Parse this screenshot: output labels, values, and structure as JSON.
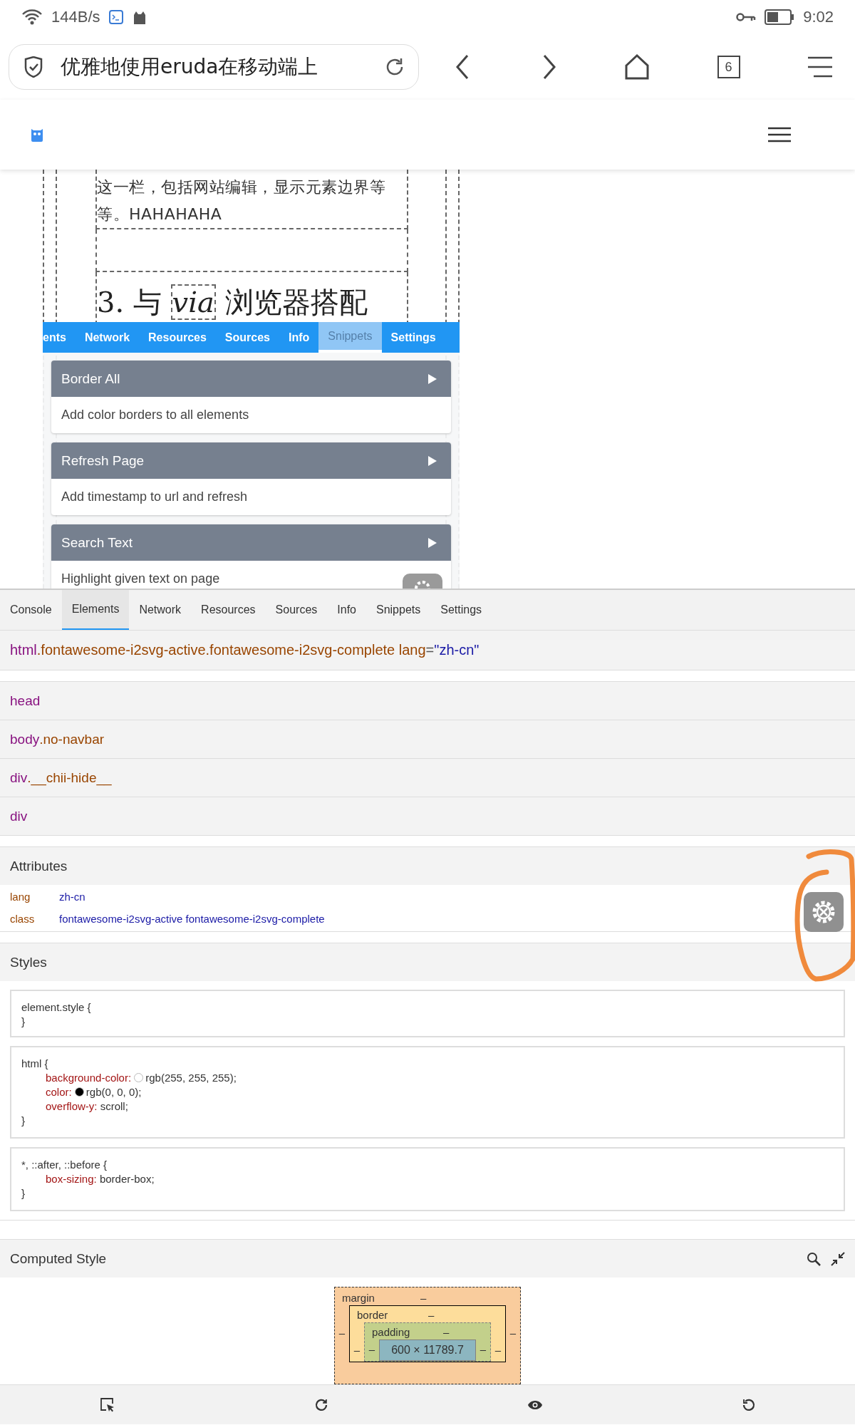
{
  "status_bar": {
    "net_speed": "144B/s",
    "time": "9:02"
  },
  "browser": {
    "title": "优雅地使用eruda在移动端上",
    "tab_count": "6"
  },
  "page": {
    "paragraph": "这一栏，包括网站编辑，显示元素边界等等。HAHAHAHA",
    "heading": {
      "prefix": "3. 与 ",
      "code": "via",
      "suffix": " 浏览器搭配"
    }
  },
  "mini_devtools": {
    "tabs": [
      {
        "label": "ents",
        "selected": false
      },
      {
        "label": "Network",
        "selected": false
      },
      {
        "label": "Resources",
        "selected": false
      },
      {
        "label": "Sources",
        "selected": false
      },
      {
        "label": "Info",
        "selected": false
      },
      {
        "label": "Snippets",
        "selected": true
      },
      {
        "label": "Settings",
        "selected": false
      }
    ],
    "snippets": [
      {
        "name": "Border All",
        "description": "Add color borders to all elements"
      },
      {
        "name": "Refresh Page",
        "description": "Add timestamp to url and refresh"
      },
      {
        "name": "Search Text",
        "description": "Highlight given text on page"
      }
    ]
  },
  "devtools": {
    "tabs": [
      {
        "label": "Console",
        "selected": false
      },
      {
        "label": "Elements",
        "selected": true
      },
      {
        "label": "Network",
        "selected": false
      },
      {
        "label": "Resources",
        "selected": false
      },
      {
        "label": "Sources",
        "selected": false
      },
      {
        "label": "Info",
        "selected": false
      },
      {
        "label": "Snippets",
        "selected": false
      },
      {
        "label": "Settings",
        "selected": false
      }
    ],
    "selected_element": {
      "tag": "html",
      "classes": ".fontawesome-i2svg-active.fontawesome-i2svg-complete",
      "attr_name": "lang",
      "separator": "=",
      "attr_value": "\"zh-cn\""
    },
    "children": [
      {
        "tag": "head"
      },
      {
        "tag": "body",
        "classes": ".no-navbar"
      },
      {
        "tag": "div",
        "classes": ".__chii-hide__"
      },
      {
        "tag": "div"
      }
    ],
    "attributes": {
      "title": "Attributes",
      "items": [
        {
          "name": "lang",
          "value": "zh-cn"
        },
        {
          "name": "class",
          "value": "fontawesome-i2svg-active fontawesome-i2svg-complete"
        }
      ]
    },
    "styles": {
      "title": "Styles",
      "rules": [
        {
          "selector": "element.style {",
          "close": "}"
        },
        {
          "selector": "html {",
          "declarations": [
            {
              "property": "background-color:",
              "value": "rgb(255, 255, 255);",
              "color": "#ffffff"
            },
            {
              "property": "color:",
              "value": "rgb(0, 0, 0);",
              "color": "#000000"
            },
            {
              "property": "overflow-y:",
              "value": "scroll;"
            }
          ],
          "close": "}"
        },
        {
          "selector": "*, ::after, ::before {",
          "declarations": [
            {
              "property": "box-sizing:",
              "value": "border-box;"
            }
          ],
          "close": "}"
        }
      ]
    },
    "computed": {
      "title": "Computed Style",
      "box_model": {
        "margin": {
          "label": "margin",
          "top": "–",
          "left": "–",
          "right": "–"
        },
        "border": {
          "label": "border",
          "top": "–",
          "left": "–",
          "right": "–"
        },
        "padding": {
          "label": "padding",
          "top": "–",
          "left": "–",
          "right": "–"
        },
        "content": "600 × 11789.7"
      }
    }
  }
}
